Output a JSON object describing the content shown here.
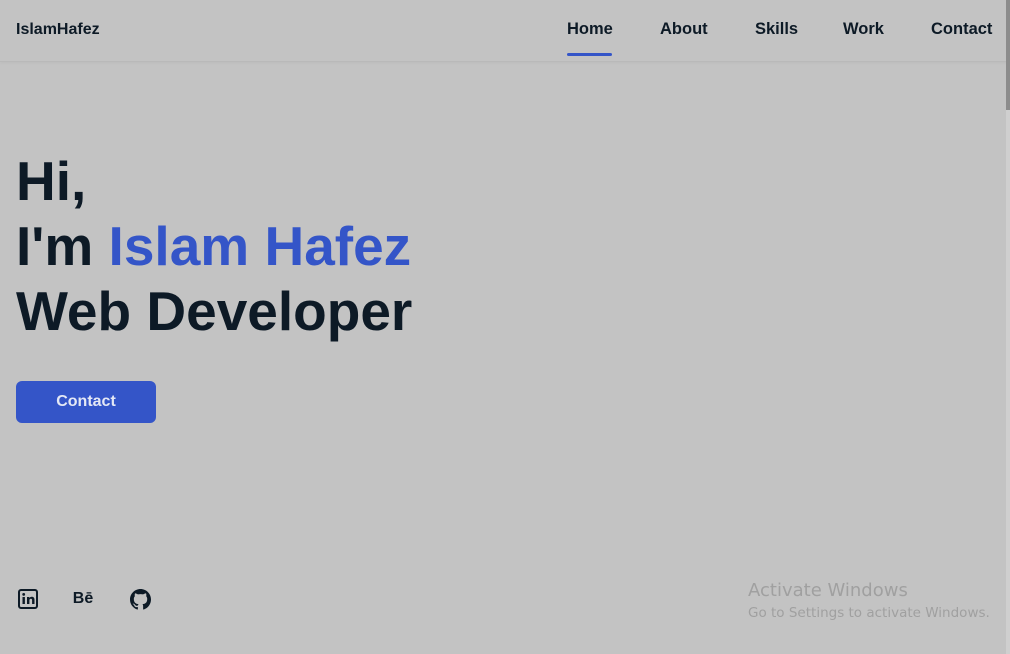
{
  "header": {
    "logo": "IslamHafez",
    "nav": [
      {
        "label": "Home",
        "active": true
      },
      {
        "label": "About"
      },
      {
        "label": "Skills"
      },
      {
        "label": "Work"
      },
      {
        "label": "Contact"
      }
    ]
  },
  "hero": {
    "greeting": "Hi,",
    "intro_prefix": "I'm ",
    "name": "Islam Hafez",
    "role": "Web Developer",
    "contact_button": "Contact"
  },
  "social": [
    {
      "icon": "linkedin-icon"
    },
    {
      "icon": "behance-icon",
      "label": "Bē"
    },
    {
      "icon": "github-icon"
    }
  ],
  "watermark": {
    "title": "Activate Windows",
    "subtitle": "Go to Settings to activate Windows."
  },
  "colors": {
    "accent": "#3455c8",
    "text": "#0d1a26",
    "background": "#c3c3c3"
  }
}
